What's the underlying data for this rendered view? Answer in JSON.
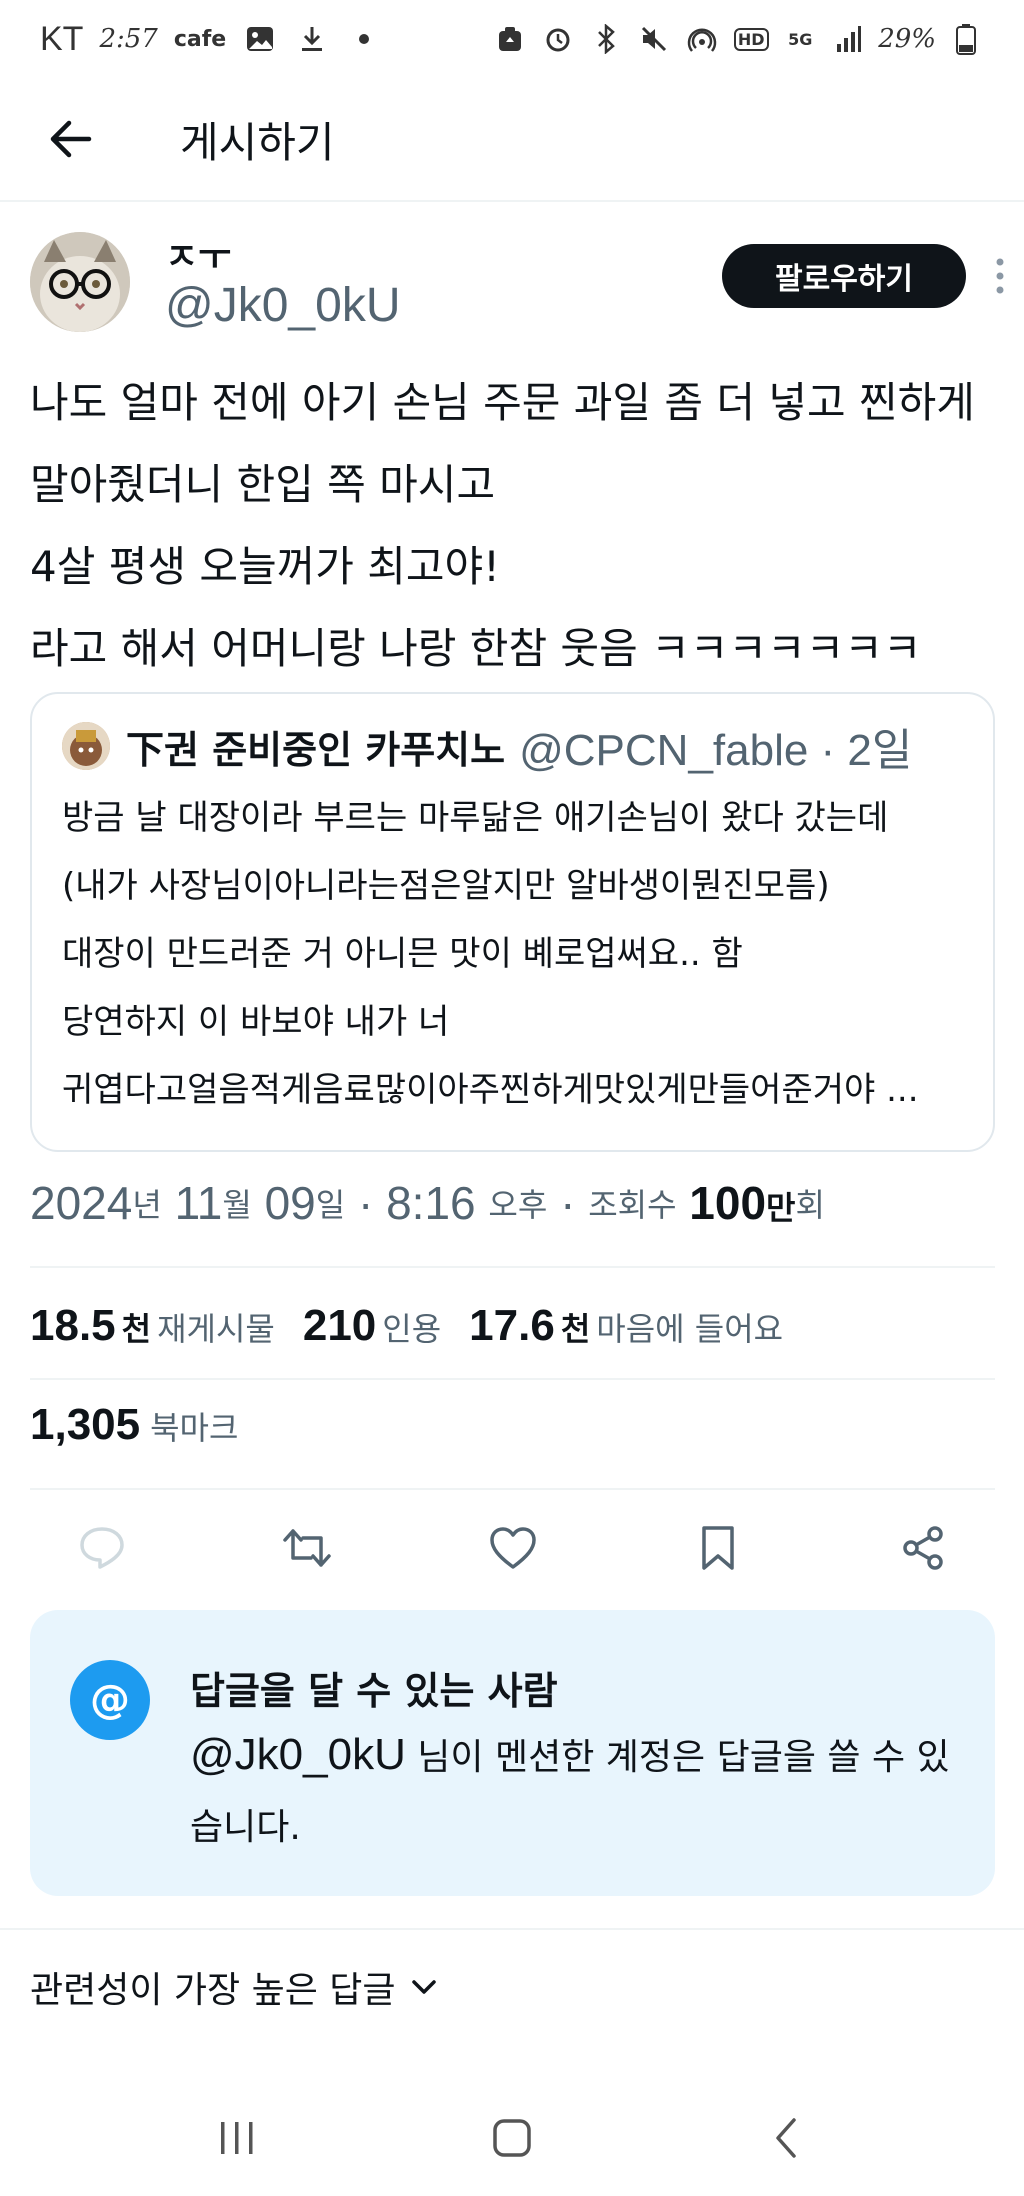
{
  "status_bar": {
    "carrier": "KT",
    "time": "2:57",
    "app_label": "cafe",
    "battery_percent": "29%",
    "hd_label": "HD",
    "network_label": "5G"
  },
  "header": {
    "title": "게시하기"
  },
  "post": {
    "display_name": "ㅈㅜ",
    "handle": "@Jk0_0kU",
    "follow_label": "팔로우하기",
    "body_lines": [
      "나도 얼마 전에 아기 손님 주문 과일 좀 더 넣고 찐하게",
      "말아줬더니 한입 쪽 마시고",
      "4살 평생 오늘꺼가 최고야!",
      "라고 해서 어머니랑 나랑 한참 웃음 ㅋㅋㅋㅋㅋㅋㅋ"
    ],
    "timestamp": {
      "year": "2024",
      "year_unit": "년",
      "month": "11",
      "month_unit": "월",
      "day": "09",
      "day_unit": "일",
      "sep1": "·",
      "time": "8:16",
      "ampm": "오후",
      "sep2": "·",
      "views_label": "조회수",
      "views_num": "100",
      "views_unit": "만",
      "views_suffix": "회"
    },
    "stats": [
      {
        "num": "18.5",
        "unit": "천",
        "label": "재게시물"
      },
      {
        "num": "210",
        "unit": "",
        "label": "인용"
      },
      {
        "num": "17.6",
        "unit": "천",
        "label": "마음에 들어요"
      }
    ],
    "bookmarks": {
      "num": "1,305",
      "label": "북마크"
    }
  },
  "quote": {
    "name": "下권 준비중인 카푸치노",
    "handle_time": "@CPCN_fable · 2일",
    "body_lines": [
      "방금 날 대장이라 부르는 마루닮은 애기손님이 왔다 갔는데",
      "(내가 사장님이아니라는점은알지만 알바생이뭔진모름)",
      "대장이 만드러준 거 아니믄 맛이 볘로업써요.. 함",
      "당연하지 이 바보야 내가 너",
      "귀엽다고얼음적게음료많이아주찐하게맛있게만들어준거야 ..."
    ]
  },
  "reply_card": {
    "at_symbol": "@",
    "title": "답글을 달 수 있는 사람",
    "mention": "@Jk0_0kU",
    "desc": " 님이 멘션한 계정은 답글을 쓸 수 있습니다."
  },
  "sort": {
    "label": "관련성이 가장 높은 답글"
  },
  "colors": {
    "accent": "#1d9bf0",
    "reply_card_bg": "#e8f5fd",
    "muted_text": "#536471",
    "follow_bg": "#0f1419"
  }
}
